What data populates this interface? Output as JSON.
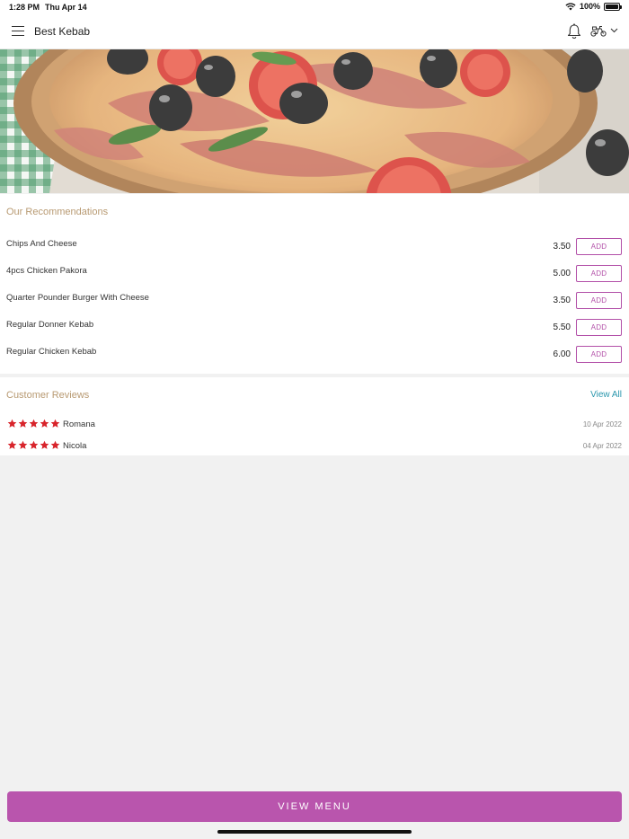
{
  "status_bar": {
    "time": "1:28 PM",
    "date": "Thu Apr 14",
    "battery": "100%"
  },
  "header": {
    "title": "Best Kebab",
    "menu_icon": "hamburger-icon",
    "notification_icon": "bell-icon",
    "delivery_icon": "scooter-icon"
  },
  "hero": {
    "image": "pizza-hero-image"
  },
  "recommendations": {
    "title": "Our Recommendations",
    "items": [
      {
        "name": "Chips And Cheese",
        "price": "3.50",
        "button": "ADD"
      },
      {
        "name": "4pcs Chicken Pakora",
        "price": "5.00",
        "button": "ADD"
      },
      {
        "name": "Quarter Pounder Burger With Cheese",
        "price": "3.50",
        "button": "ADD"
      },
      {
        "name": "Regular Donner Kebab",
        "price": "5.50",
        "button": "ADD"
      },
      {
        "name": "Regular Chicken Kebab",
        "price": "6.00",
        "button": "ADD"
      }
    ]
  },
  "reviews": {
    "title": "Customer Reviews",
    "view_all": "View All",
    "items": [
      {
        "name": "Romana",
        "date": "10 Apr 2022",
        "rating": 5
      },
      {
        "name": "Nicola",
        "date": "04 Apr 2022",
        "rating": 5
      }
    ]
  },
  "footer": {
    "button_label": "VIEW MENU"
  },
  "colors": {
    "accent": "#b955ad",
    "section_title": "#b89a72",
    "link": "#2a97ad",
    "star": "#d8242b"
  }
}
